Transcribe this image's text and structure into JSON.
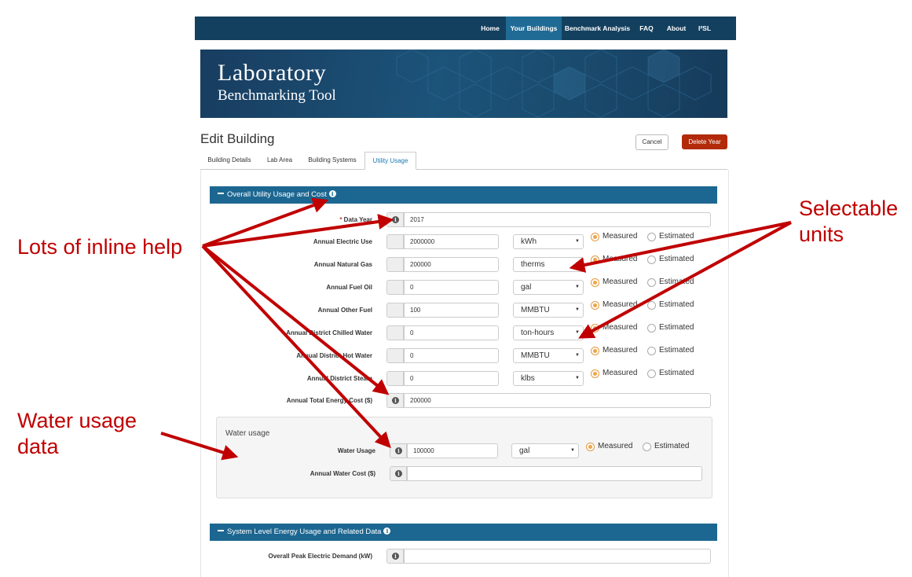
{
  "nav": {
    "items": [
      "Home",
      "Your Buildings",
      "Benchmark Analysis",
      "FAQ",
      "About",
      "I²SL"
    ],
    "active": "Your Buildings"
  },
  "banner": {
    "line1": "Laboratory",
    "line2": "Benchmarking Tool"
  },
  "page": {
    "title": "Edit Building",
    "cancel_label": "Cancel",
    "delete_label": "Delete Year"
  },
  "tabs": [
    "Building Details",
    "Lab Area",
    "Building Systems",
    "Utility Usage"
  ],
  "active_tab": "Utility Usage",
  "section1": {
    "title": "Overall Utility Usage and Cost",
    "data_year_required": "*",
    "data_year_label": "Data Year",
    "data_year_value": "2017",
    "rows": [
      {
        "label": "Annual Electric Use",
        "value": "2000000",
        "unit": "kWh",
        "measured": true
      },
      {
        "label": "Annual Natural Gas",
        "value": "200000",
        "unit": "therms",
        "measured": true
      },
      {
        "label": "Annual Fuel Oil",
        "value": "0",
        "unit": "gal",
        "measured": true
      },
      {
        "label": "Annual Other Fuel",
        "value": "100",
        "unit": "MMBTU",
        "measured": true
      },
      {
        "label": "Annual District Chilled Water",
        "value": "0",
        "unit": "ton-hours",
        "measured": true
      },
      {
        "label": "Annual District Hot Water",
        "value": "0",
        "unit": "MMBTU",
        "measured": true
      },
      {
        "label": "Annual District Steam",
        "value": "0",
        "unit": "klbs",
        "measured": true
      }
    ],
    "measured_label": "Measured",
    "estimated_label": "Estimated",
    "total_cost_label": "Annual Total Energy Cost ($)",
    "total_cost_value": "200000"
  },
  "water": {
    "title": "Water usage",
    "usage_label": "Water Usage",
    "usage_value": "100000",
    "usage_unit": "gal",
    "measured_label": "Measured",
    "estimated_label": "Estimated",
    "cost_label": "Annual Water Cost ($)",
    "cost_value": ""
  },
  "section2": {
    "title": "System Level Energy Usage and Related Data",
    "peak_label": "Overall Peak Electric Demand (kW)",
    "peak_value": ""
  },
  "annotations": {
    "inline_help": "Lots of inline help",
    "units_line1": "Selectable",
    "units_line2": "units",
    "water_line1": "Water usage",
    "water_line2": "data"
  },
  "colors": {
    "nav_bg": "#14405f",
    "nav_active": "#1f6b95",
    "section_header": "#1c6791",
    "delete_button": "#b22a0a",
    "annotation": "#c00000",
    "radio_on": "#f0a34a"
  }
}
